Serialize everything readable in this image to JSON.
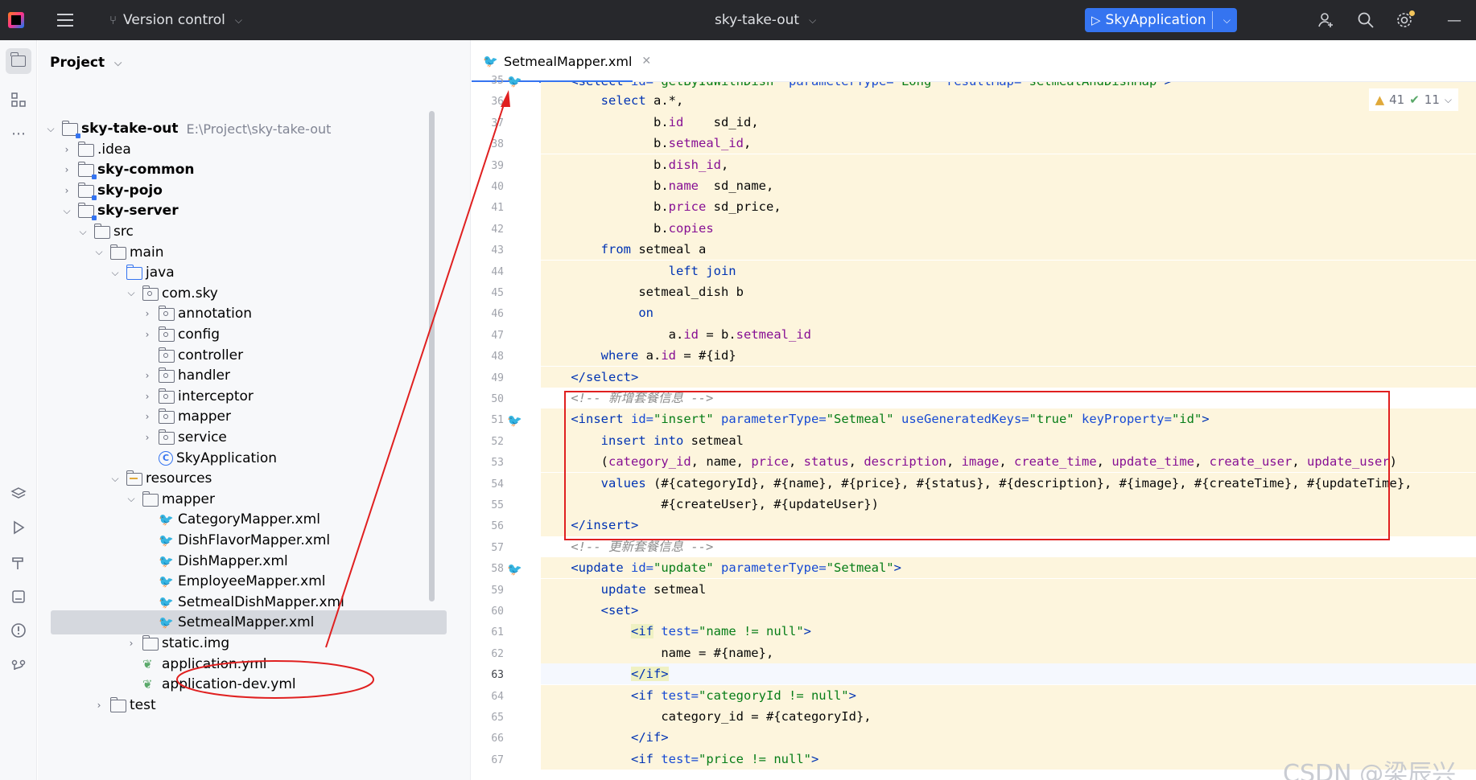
{
  "titlebar": {
    "version_control": "Version control",
    "project_name": "sky-take-out",
    "run_config": "SkyApplication"
  },
  "project_panel": {
    "title": "Project",
    "tree": [
      {
        "label": "sky-take-out",
        "path": "E:\\Project\\sky-take-out",
        "bold": true
      },
      {
        "label": ".idea"
      },
      {
        "label": "sky-common",
        "bold": true
      },
      {
        "label": "sky-pojo",
        "bold": true
      },
      {
        "label": "sky-server",
        "bold": true
      },
      {
        "label": "src"
      },
      {
        "label": "main"
      },
      {
        "label": "java"
      },
      {
        "label": "com.sky"
      },
      {
        "label": "annotation"
      },
      {
        "label": "config"
      },
      {
        "label": "controller"
      },
      {
        "label": "handler"
      },
      {
        "label": "interceptor"
      },
      {
        "label": "mapper"
      },
      {
        "label": "service"
      },
      {
        "label": "SkyApplication"
      },
      {
        "label": "resources"
      },
      {
        "label": "mapper"
      },
      {
        "label": "CategoryMapper.xml"
      },
      {
        "label": "DishFlavorMapper.xml"
      },
      {
        "label": "DishMapper.xml"
      },
      {
        "label": "EmployeeMapper.xml"
      },
      {
        "label": "SetmealDishMapper.xml"
      },
      {
        "label": "SetmealMapper.xml",
        "selected": true
      },
      {
        "label": "static.img"
      },
      {
        "label": "application.yml"
      },
      {
        "label": "application-dev.yml"
      },
      {
        "label": "test"
      }
    ]
  },
  "editor": {
    "tab_label": "SetmealMapper.xml",
    "warnings": "41",
    "weak_warnings": "11",
    "line_numbers": [
      "35",
      "36",
      "37",
      "38",
      "39",
      "40",
      "41",
      "42",
      "43",
      "44",
      "45",
      "46",
      "47",
      "48",
      "49",
      "50",
      "51",
      "52",
      "53",
      "54",
      "55",
      "56",
      "57",
      "58",
      "59",
      "60",
      "61",
      "62",
      "63",
      "64",
      "65",
      "66",
      "67"
    ]
  },
  "watermark": "CSDN @梁辰兴"
}
